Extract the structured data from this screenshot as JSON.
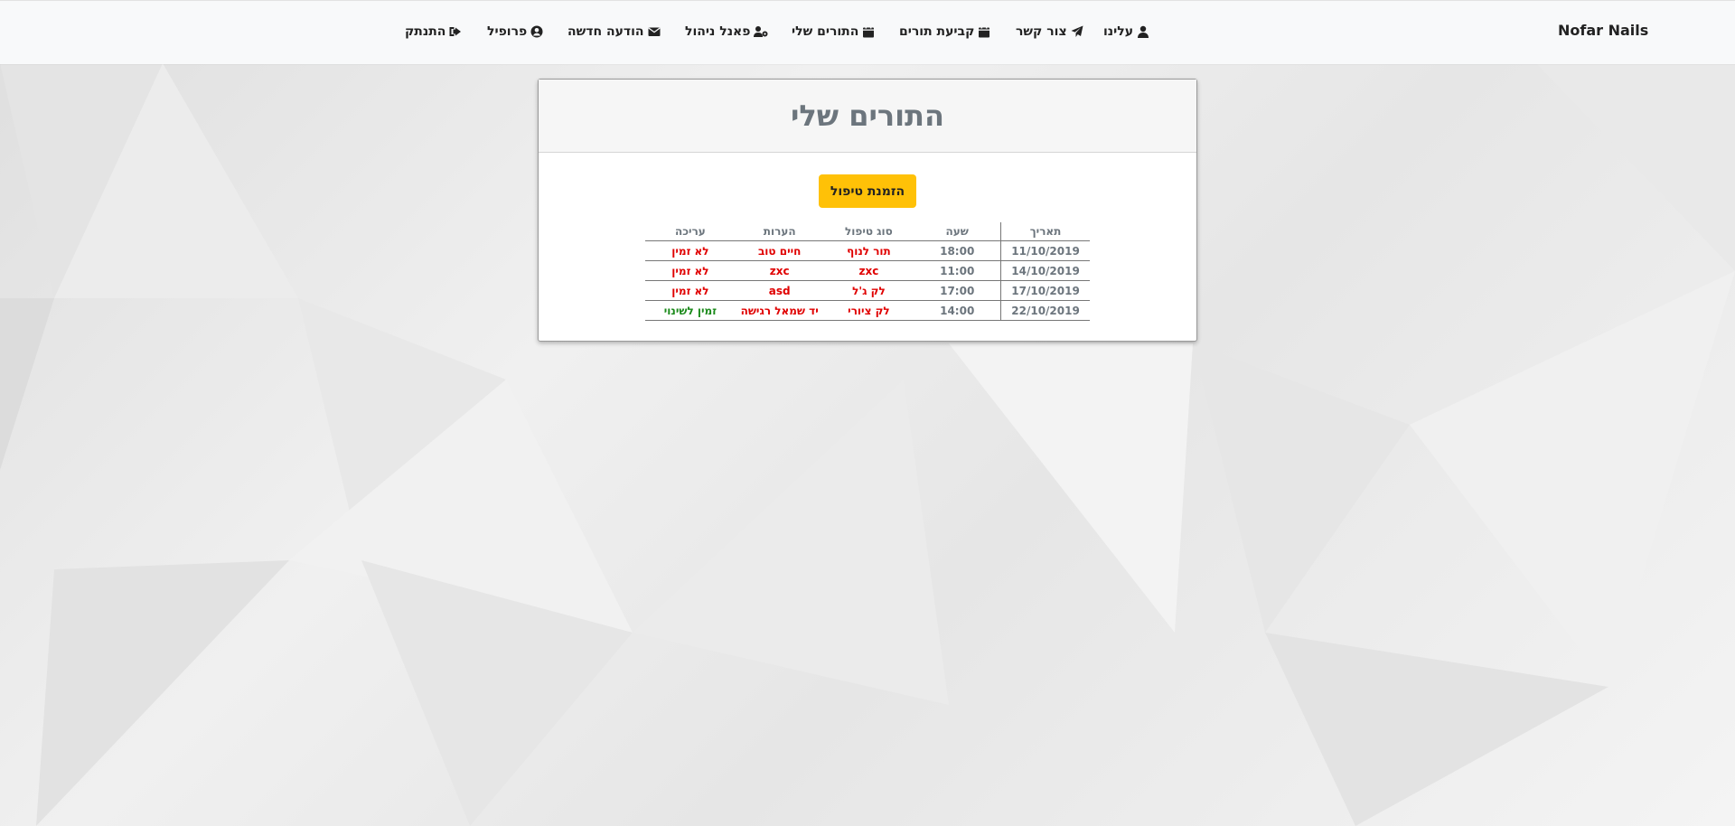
{
  "navbar": {
    "brand": "Nofar Nails",
    "items": [
      {
        "label": "עלינו",
        "icon": "user-icon"
      },
      {
        "label": "צור קשר",
        "icon": "paper-plane-icon"
      },
      {
        "label": "קביעת תורים",
        "icon": "calendar-icon"
      },
      {
        "label": "התורים שלי",
        "icon": "calendar-icon"
      },
      {
        "label": "פאנל ניהול",
        "icon": "users-cog-icon"
      },
      {
        "label": "הודעה חדשה",
        "icon": "envelope-icon"
      },
      {
        "label": "פרופיל",
        "icon": "user-circle-icon"
      },
      {
        "label": "התנתק",
        "icon": "sign-out-icon"
      }
    ]
  },
  "card": {
    "title": "התורים שלי",
    "book_button": "הזמנת טיפול"
  },
  "table": {
    "headers": {
      "date": "תאריך",
      "time": "שעה",
      "type": "סוג טיפול",
      "notes": "הערות",
      "edit": "עריכה"
    },
    "rows": [
      {
        "date": "11/10/2019",
        "time": "18:00",
        "type": "תור לנוף",
        "notes": "חיים טוב",
        "edit": "לא זמין"
      },
      {
        "date": "14/10/2019",
        "time": "11:00",
        "type": "zxc",
        "notes": "zxc",
        "edit": "לא זמין"
      },
      {
        "date": "17/10/2019",
        "time": "17:00",
        "type": "לק ג'ל",
        "notes": "asd",
        "edit": "לא זמין"
      },
      {
        "date": "22/10/2019",
        "time": "14:00",
        "type": "לק ציורי",
        "notes": "יד שמאל רגישה",
        "edit": "זמין לשינוי"
      }
    ]
  },
  "colors": {
    "accent_button": "#ffc107",
    "unavailable": "#e00000",
    "available": "#1b8a1b",
    "muted_text": "#6c757d"
  }
}
